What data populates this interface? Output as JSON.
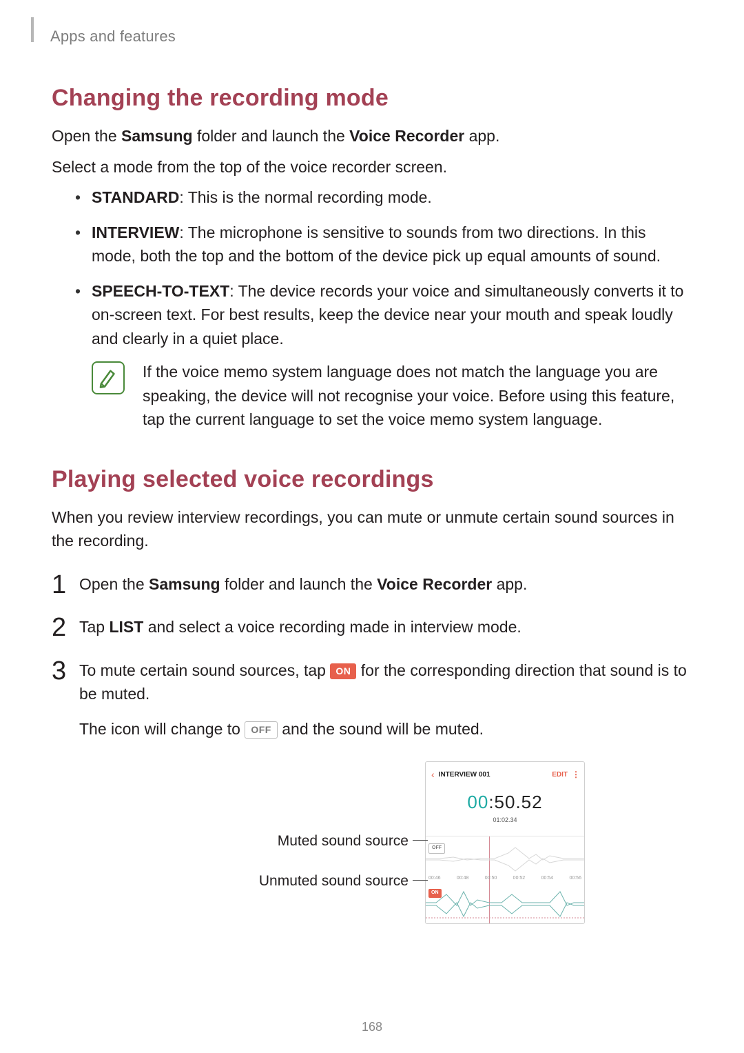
{
  "header": {
    "breadcrumb": "Apps and features"
  },
  "section1": {
    "title": "Changing the recording mode",
    "intro_pre": "Open the ",
    "intro_bold1": "Samsung",
    "intro_mid": " folder and launch the ",
    "intro_bold2": "Voice Recorder",
    "intro_post": " app.",
    "para2": "Select a mode from the top of the voice recorder screen.",
    "items": {
      "standard": {
        "label": "STANDARD",
        "text": ": This is the normal recording mode."
      },
      "interview": {
        "label": "INTERVIEW",
        "text": ": The microphone is sensitive to sounds from two directions. In this mode, both the top and the bottom of the device pick up equal amounts of sound."
      },
      "speech": {
        "label": "SPEECH-TO-TEXT",
        "text": ": The device records your voice and simultaneously converts it to on-screen text. For best results, keep the device near your mouth and speak loudly and clearly in a quiet place."
      }
    },
    "note": "If the voice memo system language does not match the language you are speaking, the device will not recognise your voice. Before using this feature, tap the current language to set the voice memo system language."
  },
  "section2": {
    "title": "Playing selected voice recordings",
    "intro": "When you review interview recordings, you can mute or unmute certain sound sources in the recording.",
    "step1_pre": "Open the ",
    "step1_bold1": "Samsung",
    "step1_mid": " folder and launch the ",
    "step1_bold2": "Voice Recorder",
    "step1_post": " app.",
    "step2_pre": "Tap ",
    "step2_bold": "LIST",
    "step2_post": " and select a voice recording made in interview mode.",
    "step3_pre": "To mute certain sound sources, tap ",
    "step3_on": "ON",
    "step3_post": " for the corresponding direction that sound is to be muted.",
    "step3_line2_pre": "The icon will change to ",
    "step3_off": "OFF",
    "step3_line2_post": " and the sound will be muted."
  },
  "figure": {
    "callout_muted": "Muted sound source",
    "callout_unmuted": "Unmuted sound source",
    "phone": {
      "title": "INTERVIEW 001",
      "edit": "EDIT",
      "time_main_teal": "00",
      "time_main_rest": ":50.52",
      "time_sub": "01:02.34",
      "tag_off": "OFF",
      "tag_on": "ON",
      "ticks": [
        "00:46",
        "00:48",
        "00:50",
        "00:52",
        "00:54",
        "00:56"
      ]
    }
  },
  "page_number": "168"
}
